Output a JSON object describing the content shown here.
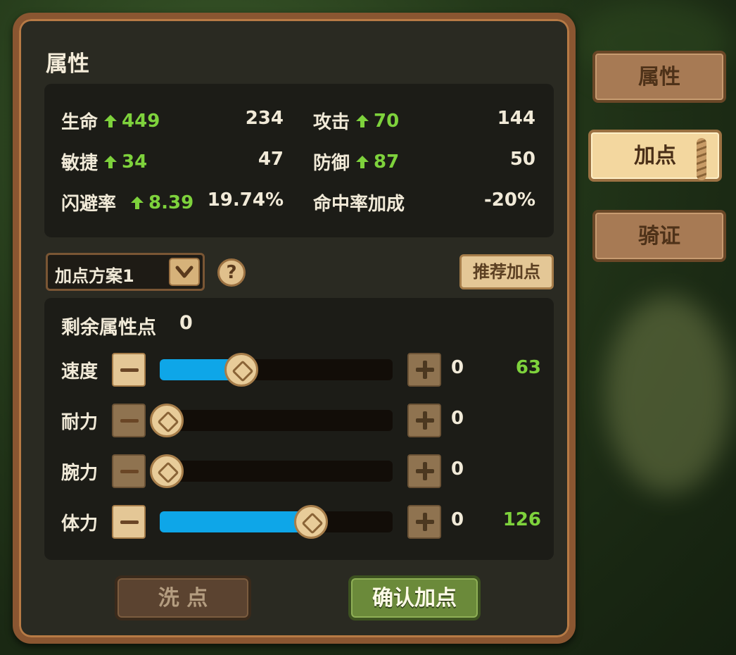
{
  "panel": {
    "title": "属性"
  },
  "stats": {
    "hp": {
      "label": "生命",
      "bonus": "449",
      "value": "234"
    },
    "attack": {
      "label": "攻击",
      "bonus": "70",
      "value": "144"
    },
    "agility": {
      "label": "敏捷",
      "bonus": "34",
      "value": "47"
    },
    "defense": {
      "label": "防御",
      "bonus": "87",
      "value": "50"
    },
    "dodge": {
      "label": "闪避率",
      "bonus": "8.39",
      "value": "19.74%"
    },
    "hit_bonus": {
      "label": "命中率加成",
      "value": "-20%"
    }
  },
  "plan": {
    "selected": "加点方案1",
    "help_symbol": "?",
    "recommend_label": "推荐加点"
  },
  "allocation": {
    "remaining_label": "剩余属性点",
    "remaining_value": "0",
    "rows": [
      {
        "label": "速度",
        "allocated": "0",
        "bonus": "63",
        "level": 0.35
      },
      {
        "label": "耐力",
        "allocated": "0",
        "bonus": "",
        "level": 0.0
      },
      {
        "label": "腕力",
        "allocated": "0",
        "bonus": "",
        "level": 0.0
      },
      {
        "label": "体力",
        "allocated": "0",
        "bonus": "126",
        "level": 0.65
      }
    ]
  },
  "actions": {
    "reset_label": "洗 点",
    "confirm_label": "确认加点"
  },
  "tabs": [
    {
      "label": "属性",
      "active": false
    },
    {
      "label": "加点",
      "active": true
    },
    {
      "label": "骑证",
      "active": false
    }
  ],
  "colors": {
    "accent_green": "#7ed23c",
    "slider_fill": "#0ea6e8",
    "panel_border": "#8a5631"
  }
}
